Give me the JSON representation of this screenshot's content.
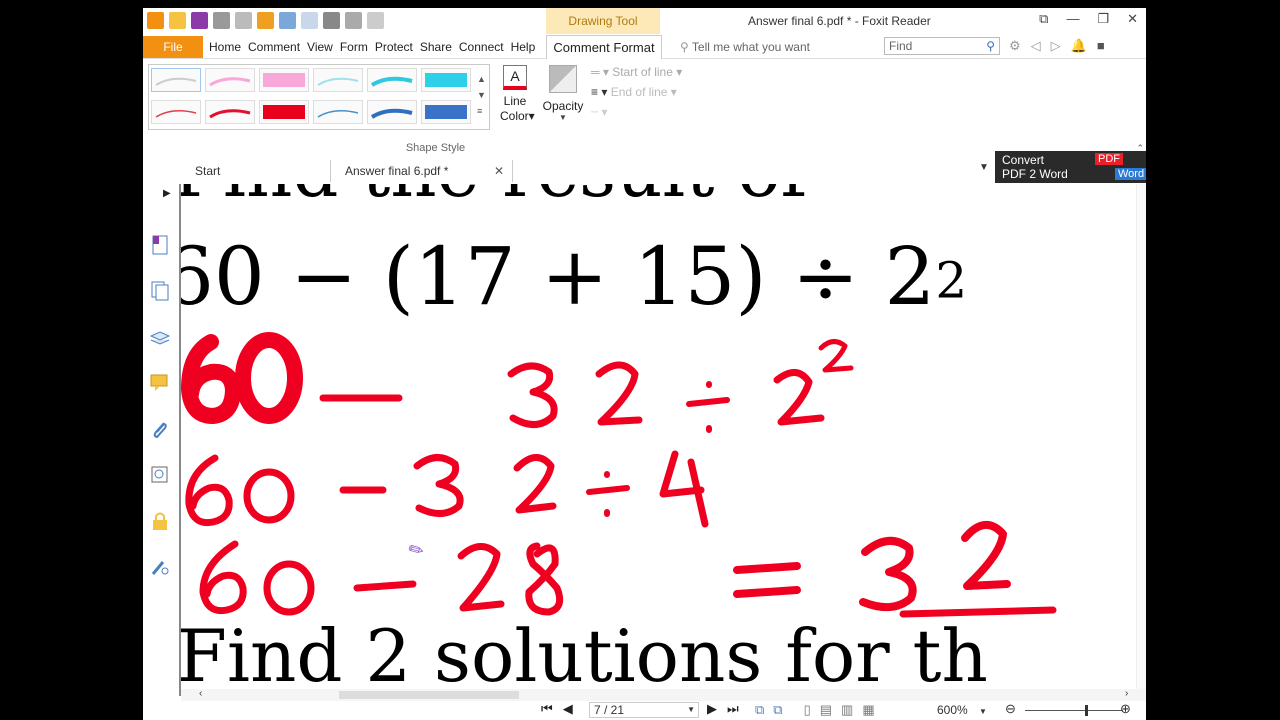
{
  "window": {
    "title": "Answer final 6.pdf * - Foxit Reader",
    "context_tab": "Drawing Tool"
  },
  "menu": {
    "file": "File",
    "items": [
      "Home",
      "Comment",
      "View",
      "Form",
      "Protect",
      "Share",
      "Connect",
      "Help"
    ],
    "active_tab": "Comment Format",
    "tell_me": "Tell me what you want",
    "find_placeholder": "Find"
  },
  "ribbon": {
    "line_color_label": "Line\nColor",
    "opacity_label": "Opacity",
    "start_of_line": "Start of line",
    "end_of_line": "End of line",
    "group_name": "Shape Style"
  },
  "doc_tabs": {
    "start": "Start",
    "current": "Answer final 6.pdf *"
  },
  "convert_banner": {
    "line1": "Convert",
    "line2": "PDF 2 Word",
    "badge_pdf": "PDF",
    "badge_word": "Word"
  },
  "document": {
    "partial_heading": "Find the result of",
    "expression": "60 − (17 + 15) ÷ 2",
    "exponent": "2",
    "handwritten": {
      "line1": "60 −   32 ÷ 2²",
      "line2": "60 − 32 ÷ 4",
      "line3_left": "60 − 28",
      "line3_right": "= 32"
    },
    "next_heading": "Find 2 solutions for th"
  },
  "status": {
    "page": "7 / 21",
    "zoom": "600%"
  },
  "colors": {
    "file_button": "#f29111",
    "ink_red": "#f00020",
    "context_tab_bg": "#fde9b7"
  }
}
